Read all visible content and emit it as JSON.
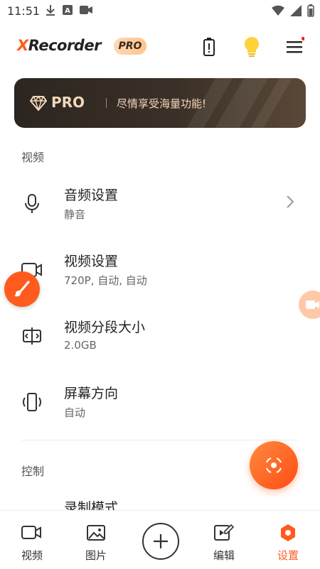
{
  "status_bar": {
    "time": "11:51"
  },
  "app": {
    "logo_x": "X",
    "logo_rest": "Recorder",
    "pro_badge": "PRO"
  },
  "pro_banner": {
    "title": "PRO",
    "text": "尽情享受海量功能!"
  },
  "sections": [
    {
      "header": "视频"
    },
    {
      "header": "控制"
    }
  ],
  "settings": [
    {
      "title": "音频设置",
      "subtitle": "静音",
      "icon": "microphone-icon"
    },
    {
      "title": "视频设置",
      "subtitle": "720P, 自动, 自动",
      "icon": "video-camera-icon"
    },
    {
      "title": "视频分段大小",
      "subtitle": "2.0GB",
      "icon": "split-icon"
    },
    {
      "title": "屏幕方向",
      "subtitle": "自动",
      "icon": "phone-rotate-icon"
    },
    {
      "title": "录制模式",
      "subtitle": "",
      "icon": "record-mode-icon"
    }
  ],
  "bottom_nav": [
    {
      "label": "视频",
      "icon": "video-icon"
    },
    {
      "label": "图片",
      "icon": "image-icon"
    },
    {
      "label": "",
      "icon": "plus-icon"
    },
    {
      "label": "编辑",
      "icon": "edit-icon"
    },
    {
      "label": "设置",
      "icon": "settings-hex-icon",
      "active": true
    }
  ],
  "colors": {
    "accent": "#ff5a1f",
    "banner_bg": "#2c2620",
    "banner_text": "#f3d6bb",
    "bulb": "#ffd23a"
  }
}
